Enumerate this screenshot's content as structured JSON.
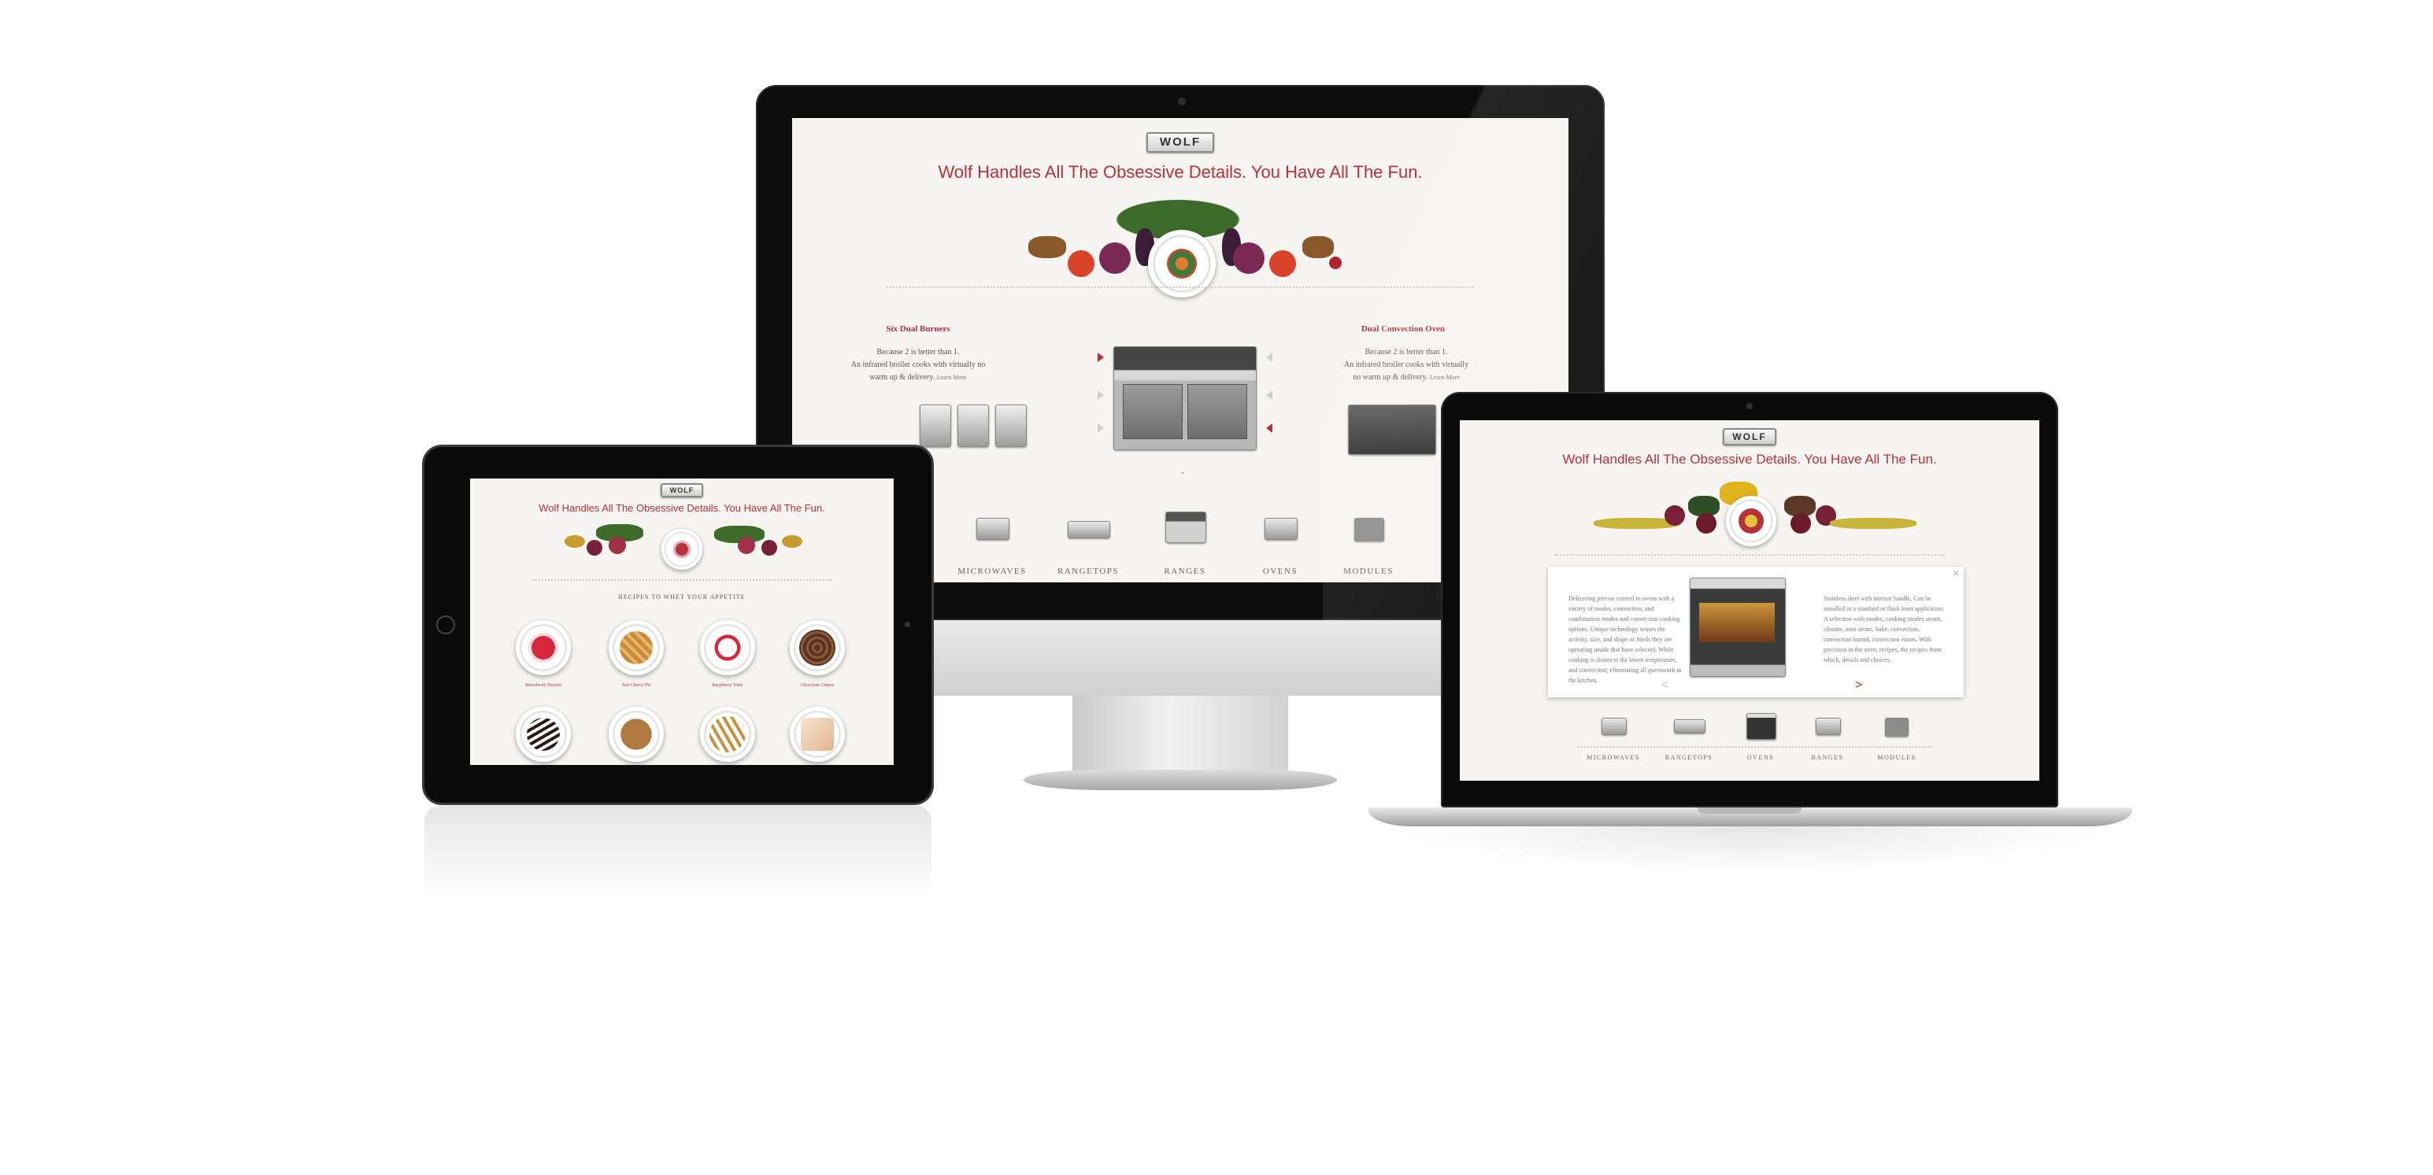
{
  "brand": {
    "logo": "WOLF",
    "headline": "Wolf Handles All The Obsessive Details. You Have All The Fun.",
    "accent": "#b8303a",
    "background": "#f6f4f0"
  },
  "imac": {
    "feature_left": {
      "title": "Six Dual Burners",
      "line1": "Because 2 is better than 1.",
      "line2": "An infrared broiler cooks with virtually no",
      "line3": "warm up & delivery.",
      "link": "Learn More"
    },
    "feature_right": {
      "title": "Dual Convection Oven",
      "line1": "Because 2 is better than 1.",
      "line2": "An infrared broiler cooks with virtually",
      "line3": "no warm up & delivery.",
      "link": "Learn More"
    },
    "nav": [
      "MICROWAVES",
      "RANGETOPS",
      "RANGES",
      "OVENS",
      "MODULES"
    ],
    "active_nav": "RANGES"
  },
  "ipad": {
    "section_title": "Recipes to whet your appetite",
    "recipes_row1": [
      "Strawberry Dessert",
      "Tart Cherry Pie",
      "Raspberry Torte",
      "Chocolate Crepes"
    ]
  },
  "macbook": {
    "nav": [
      "MICROWAVES",
      "RANGETOPS",
      "OVENS",
      "RANGES",
      "MODULES"
    ],
    "active_nav": "OVENS",
    "modal": {
      "close": "×",
      "prev": "<",
      "next": ">",
      "text_left": "Delivering precise control in ovens with a variety of modes, convection, and combination modes and convection cooking options. Unique technology senses the activity, size, and shape of foods they are operating inside that have selected. While cooking is drawn to the lower temperature, and convection, eliminating all guesswork in the kitchen.",
      "text_right": "Stainless steel with interior handle, Can be installed in a standard or flush inset application. A selection with modes, cooking modes steam, climate, auto steam, bake, convection, convection humid, convection roasts. With precision in the oven, recipes, the recipes from which, details and choices."
    }
  }
}
